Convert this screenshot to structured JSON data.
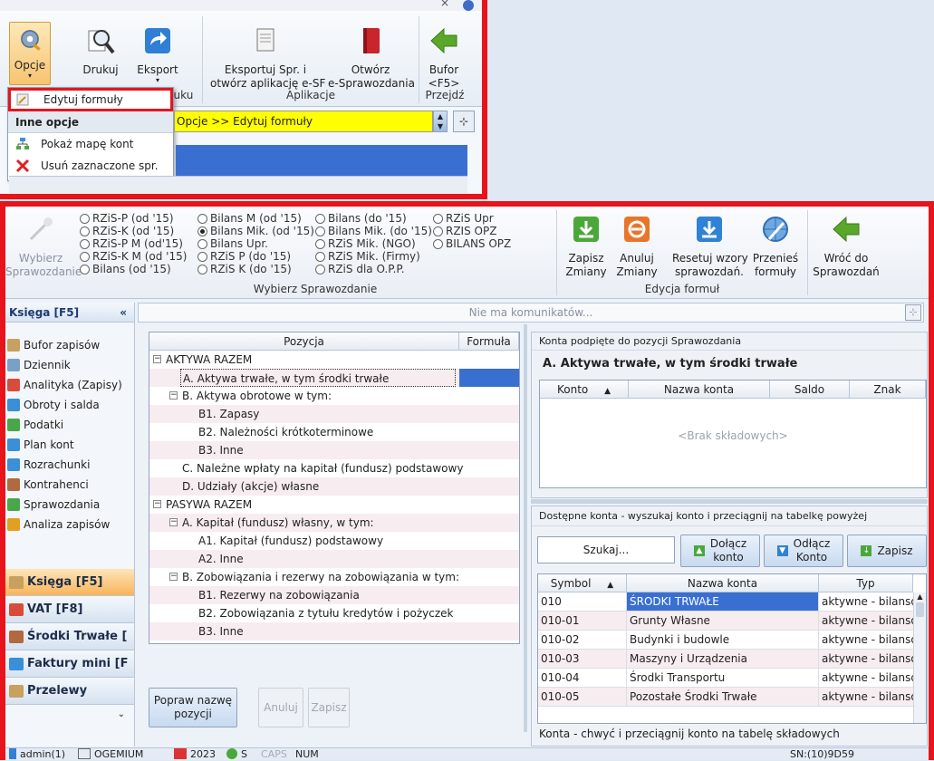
{
  "top": {
    "ribbon_buttons": [
      {
        "label": "Opcje",
        "icon": "gear-icon"
      },
      {
        "label": "Drukuj",
        "icon": "print-preview-icon"
      },
      {
        "label": "Eksport",
        "icon": "export-arrow-icon"
      },
      {
        "label": "Eksportuj Spr. i\notwórz aplikację e-SF",
        "icon": "document-export-icon"
      },
      {
        "label": "Otwórz\ne-Sprawozdania",
        "icon": "red-book-icon"
      },
      {
        "label": "Bufor\n<F5>",
        "icon": "green-arrow-left-icon"
      }
    ],
    "group_labels": {
      "print": "ruku",
      "apps": "Aplikacje",
      "go": "Przejdź"
    },
    "menu": {
      "item_edit": "Edytuj formuły",
      "header_other": "Inne opcje",
      "item_map": "Pokaż mapę kont",
      "item_delete": "Usuń zaznaczone spr."
    },
    "breadcrumb": "Opcje >> Edytuj formuły"
  },
  "ribbon": {
    "wybierz_btn": "Wybierz\nSprawozdanie",
    "radios": [
      [
        "RZiS-P (od '15)",
        "RZiS-K (od '15)",
        "RZiS-P M (od'15)",
        "RZiS-K M (od '15)",
        "Bilans (od '15)"
      ],
      [
        "Bilans M (od '15)",
        "Bilans Mik. (od '15)",
        "Bilans Upr.",
        "RZiS P (do '15)",
        "RZiS K (do '15)"
      ],
      [
        "Bilans (do '15)",
        "Bilans Mik. (do '15)",
        "RZiS Mik. (NGO)",
        "RZiS Mik. (Firmy)",
        "RZiS dla O.P.P."
      ],
      [
        "RZiS Upr",
        "RZIS OPZ",
        "BILANS OPZ"
      ]
    ],
    "group_select": "Wybierz Sprawozdanie",
    "buttons": [
      {
        "label": "Zapisz\nZmiany",
        "icon": "download-green-icon"
      },
      {
        "label": "Anuluj\nZmiany",
        "icon": "cancel-orange-icon"
      },
      {
        "label": "Resetuj wzory\nsprawozdań.",
        "icon": "reset-blue-icon"
      },
      {
        "label": "Przenieś\nformuły",
        "icon": "globe-move-icon"
      },
      {
        "label": "Wróć do\nSprawozdań",
        "icon": "green-arrow-left-icon"
      }
    ],
    "group_edit": "Edycja formuł"
  },
  "sidebar": {
    "title": "Księga [F5]",
    "items": [
      "Bufor zapisów",
      "Dziennik",
      "Analityka (Zapisy)",
      "Obroty i salda",
      "Podatki",
      "Plan kont",
      "Rozrachunki",
      "Kontrahenci",
      "Sprawozdania",
      "Analiza zapisów"
    ],
    "nav": [
      "Księga [F5]",
      "VAT [F8]",
      "Środki Trwałe [",
      "Faktury mini [F",
      "Przelewy"
    ]
  },
  "messages": "Nie ma komunikatów...",
  "tree": {
    "col_pos": "Pozycja",
    "col_formula": "Formuła",
    "rows": [
      {
        "text": "AKTYWA RAZEM",
        "level": 0,
        "expand": true
      },
      {
        "text": "A. Aktywa trwałe, w tym środki trwałe",
        "level": 1,
        "selected": true
      },
      {
        "text": "B. Aktywa obrotowe w tym:",
        "level": 1,
        "expand": true
      },
      {
        "text": "B1. Zapasy",
        "level": 2
      },
      {
        "text": "B2. Należności krótkoterminowe",
        "level": 2
      },
      {
        "text": "B3. Inne",
        "level": 2
      },
      {
        "text": "C. Należne wpłaty na kapitał (fundusz) podstawowy",
        "level": 1
      },
      {
        "text": "D. Udziały (akcje) własne",
        "level": 1
      },
      {
        "text": "PASYWA RAZEM",
        "level": 0,
        "expand": true
      },
      {
        "text": "A. Kapitał (fundusz) własny, w tym:",
        "level": 1,
        "expand": true
      },
      {
        "text": "A1. Kapitał (fundusz) podstawowy",
        "level": 2
      },
      {
        "text": "A2. Inne",
        "level": 2
      },
      {
        "text": "B. Zobowiązania i rezerwy na zobowiązania w tym:",
        "level": 1,
        "expand": true
      },
      {
        "text": "B1. Rezerwy na zobowiązania",
        "level": 2
      },
      {
        "text": "B2. Zobowiązania z tytułu kredytów i pożyczek",
        "level": 2
      },
      {
        "text": "B3. Inne",
        "level": 2
      }
    ],
    "btn_rename": "Popraw nazwę\npozycji",
    "btn_cancel": "Anuluj",
    "btn_save": "Zapisz"
  },
  "linked": {
    "title": "Konta podpięte do pozycji Sprawozdania",
    "position": "A. Aktywa trwałe, w tym środki trwałe",
    "cols": [
      "Konto",
      "Nazwa konta",
      "Saldo",
      "Znak"
    ],
    "empty": "<Brak składowych>"
  },
  "available": {
    "title": "Dostępne konta - wyszukaj konto i przeciągnij na tabelkę powyżej",
    "search": "Szukaj...",
    "btn_attach": "Dołącz\nkonto",
    "btn_detach": "Odłącz\nKonto",
    "btn_save": "Zapisz",
    "cols": [
      "Symbol",
      "Nazwa konta",
      "Typ"
    ],
    "rows": [
      [
        "010",
        "ŚRODKI TRWAŁE",
        "aktywne - bilanso"
      ],
      [
        "010-01",
        "Grunty Własne",
        "aktywne - bilanso"
      ],
      [
        "010-02",
        "Budynki i budowle",
        "aktywne - bilanso"
      ],
      [
        "010-03",
        "Maszyny i Urządzenia",
        "aktywne - bilanso"
      ],
      [
        "010-04",
        "Środki Transportu",
        "aktywne - bilanso"
      ],
      [
        "010-05",
        "Pozostałe Środki Trwałe",
        "aktywne - bilanso"
      ]
    ],
    "footer": "Konta - chwyć i przeciągnij konto na tabelę składowych"
  },
  "status": {
    "user": "admin(1)",
    "firm": "OGEMIUM",
    "year": "2023",
    "s": "S",
    "caps": "CAPS",
    "num": "NUM",
    "sn": "SN:(10)9D59"
  },
  "colors": {
    "accent_red": "#e8141c",
    "highlight_yellow": "#ffff00",
    "selection_blue": "#3a6fd2"
  }
}
